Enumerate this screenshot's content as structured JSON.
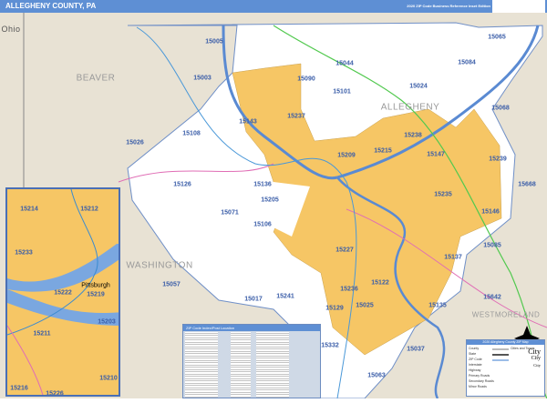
{
  "header": {
    "title": "ALLEGHENY COUNTY, PA",
    "subtitle": "2020 ZIP Code Business Reference Inset Edition",
    "logo": "Market MAPS"
  },
  "colors": {
    "header": "#5e8fd4",
    "urban": "#f6c665",
    "county_fill": "#ffffff",
    "outside": "#e8e2d4",
    "water": "#7aa7e0",
    "zip_label": "#3a5da8"
  },
  "regions": [
    "Ohio",
    "BEAVER",
    "WASHINGTON",
    "ALLEGHENY",
    "WESTMORELAND"
  ],
  "zips": [
    "15005",
    "15003",
    "15026",
    "15108",
    "15143",
    "15090",
    "15101",
    "15237",
    "15044",
    "15024",
    "15084",
    "15065",
    "15068",
    "15238",
    "15215",
    "15209",
    "15147",
    "15239",
    "15668",
    "15126",
    "15136",
    "15205",
    "15071",
    "15106",
    "15235",
    "15146",
    "15085",
    "15137",
    "15122",
    "15025",
    "15135",
    "15642",
    "15236",
    "15227",
    "15057",
    "15017",
    "15241",
    "15129",
    "15037",
    "15063",
    "15332"
  ],
  "inset": {
    "city": "Pittsburgh",
    "zips": [
      "15214",
      "15212",
      "15233",
      "15222",
      "15219",
      "15203",
      "15211",
      "15210",
      "15216",
      "15226"
    ]
  },
  "index": {
    "title": "ZIP Code Index/Post Location"
  },
  "legend": {
    "title": "2020 Allegheny County ZIP Map",
    "items": [
      "County",
      "State",
      "ZIP Code",
      "Interstate",
      "Highway",
      "Primary Roads",
      "Secondary Roads",
      "Minor Roads"
    ],
    "cities_header": "Cities and Towns",
    "city_sample": "City"
  }
}
